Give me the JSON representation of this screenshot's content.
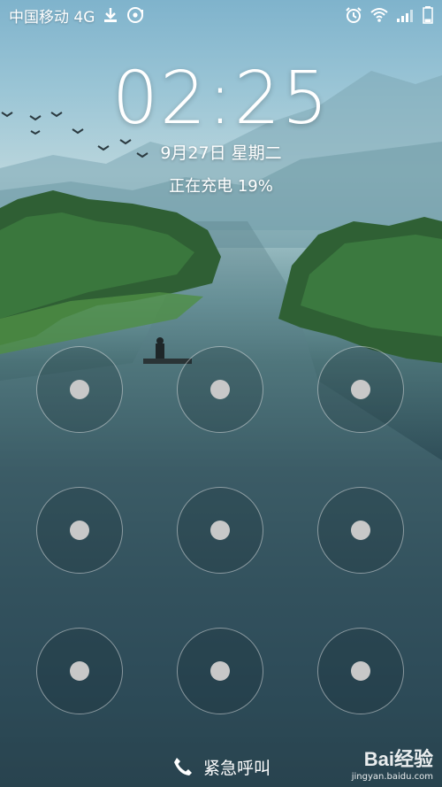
{
  "status_bar": {
    "carrier": "中国移动 4G",
    "icons_left": [
      "download-icon",
      "sync-icon"
    ],
    "icons_right": [
      "alarm-icon",
      "wifi-icon",
      "signal-icon",
      "battery-icon"
    ]
  },
  "lockscreen": {
    "time": "02:25",
    "date": "9月27日 星期二",
    "charging": "正在充电 19%"
  },
  "pattern_lock": {
    "nodes": [
      1,
      2,
      3,
      4,
      5,
      6,
      7,
      8,
      9
    ]
  },
  "emergency": {
    "label": "紧急呼叫",
    "icon": "phone-icon"
  },
  "watermark": {
    "brand": "Bai经验",
    "url": "jingyan.baidu.com"
  }
}
